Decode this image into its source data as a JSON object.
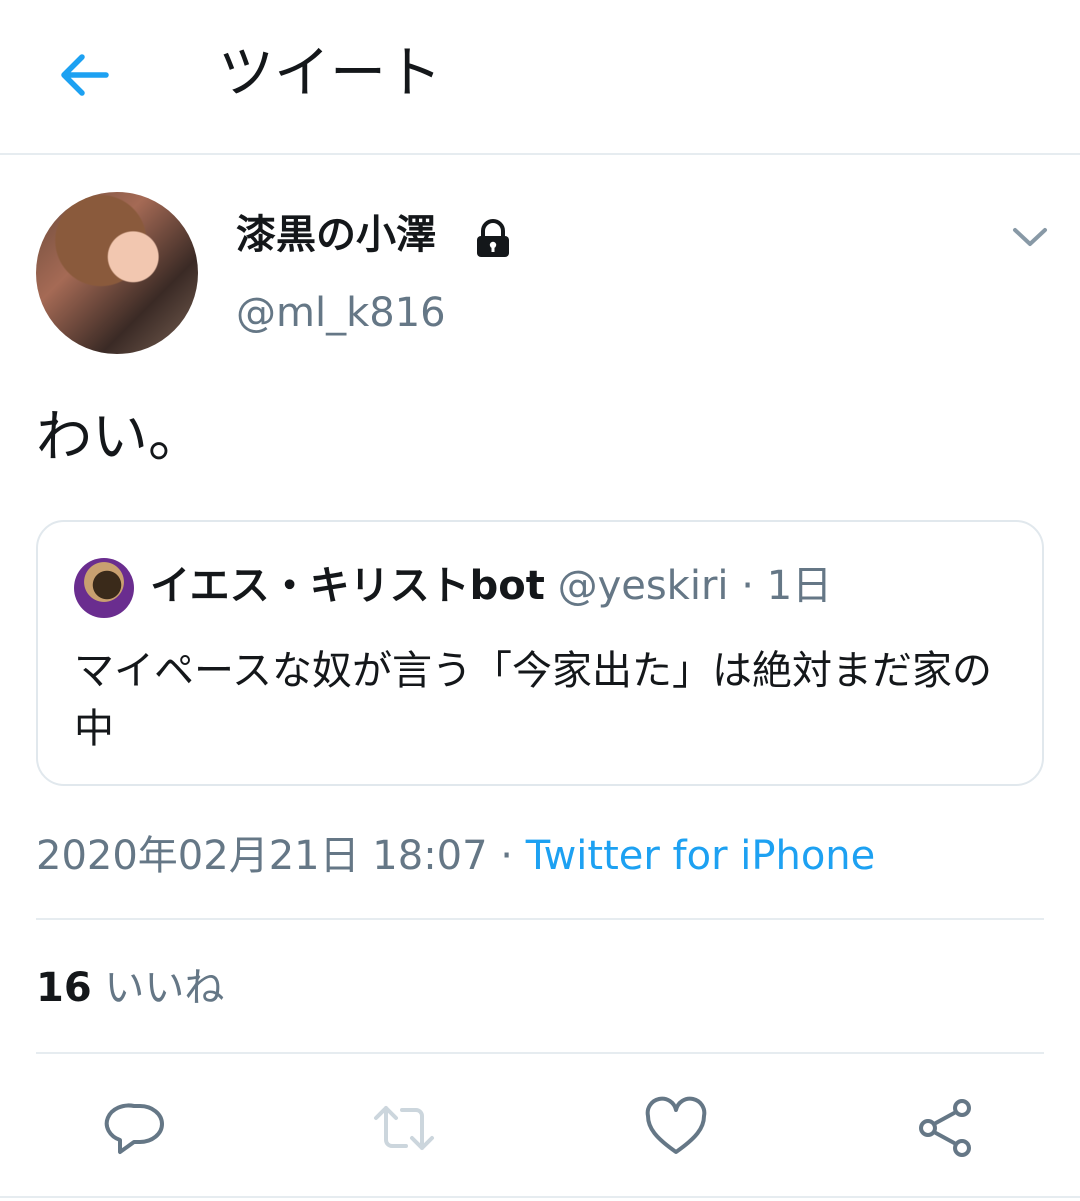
{
  "header": {
    "title": "ツイート",
    "back_icon": "arrow-left-icon",
    "accent_color": "#1da1f2"
  },
  "tweet": {
    "display_name": "漆黒の小澤",
    "protected_icon": "lock-icon",
    "handle": "@ml_k816",
    "text": "わい。",
    "timestamp": "2020年02月21日 18:07",
    "separator": " · ",
    "source": "Twitter for iPhone",
    "likes_count": "16",
    "likes_label": "いいね"
  },
  "quoted_tweet": {
    "name": "イエス・キリストbot",
    "handle": "@yeskiri",
    "separator": " · ",
    "time": "1日",
    "text": "マイペースな奴が言う「今家出た」は絶対まだ家の中"
  },
  "actions": [
    {
      "icon": "reply-icon"
    },
    {
      "icon": "retweet-icon"
    },
    {
      "icon": "like-icon"
    },
    {
      "icon": "share-icon"
    }
  ]
}
